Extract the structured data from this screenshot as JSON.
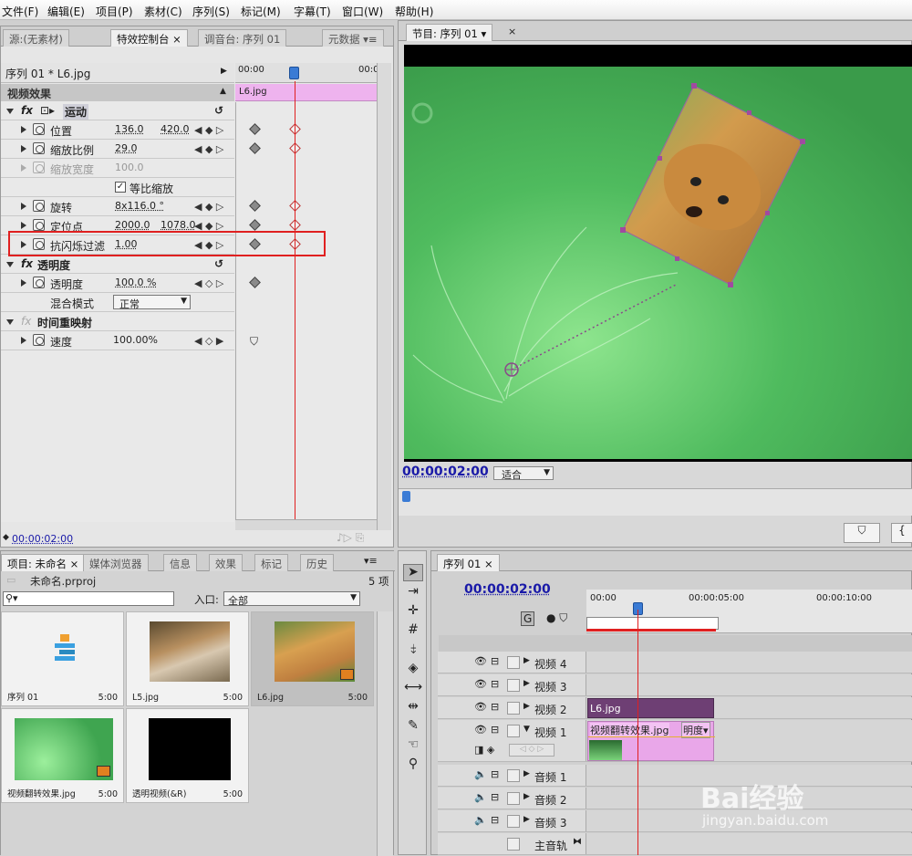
{
  "menu": [
    "文件(F)",
    "编辑(E)",
    "项目(P)",
    "素材(C)",
    "序列(S)",
    "标记(M)",
    "字幕(T)",
    "窗口(W)",
    "帮助(H)"
  ],
  "effects_panel": {
    "tabs": [
      "源:(无素材)",
      "特效控制台",
      "调音台: 序列 01",
      "元数据"
    ],
    "clip": "序列 01 * L6.jpg",
    "section": "视频效果",
    "ruler_start": "00:00",
    "ruler_end": "00:0",
    "clip_label": "L6.jpg",
    "motion": "运动",
    "props": [
      {
        "name": "位置",
        "v1": "136.0",
        "v2": "420.0"
      },
      {
        "name": "缩放比例",
        "v1": "29.0"
      },
      {
        "name": "缩放宽度",
        "v1": "100.0"
      },
      {
        "name": "等比缩放"
      },
      {
        "name": "旋转",
        "v1": "8x116.0 °"
      },
      {
        "name": "定位点",
        "v1": "2000.0",
        "v2": "1078.0"
      },
      {
        "name": "抗闪烁过滤",
        "v1": "1.00"
      }
    ],
    "opacity": "透明度",
    "opacity_prop": {
      "name": "透明度",
      "v1": "100.0 %"
    },
    "blend_label": "混合模式",
    "blend_value": "正常",
    "time_remap": "时间重映射",
    "speed": {
      "name": "速度",
      "v1": "100.00%"
    },
    "timecode": "00:00:02:00"
  },
  "program": {
    "tab": "节目: 序列 01",
    "timecode": "00:00:02:00",
    "fit": "适合"
  },
  "project": {
    "tabs": [
      "项目: 未命名",
      "媒体浏览器",
      "信息",
      "效果",
      "标记",
      "历史"
    ],
    "file": "未命名.prproj",
    "count": "5 项",
    "in_label": "入口:",
    "in_value": "全部",
    "items": [
      {
        "name": "序列 01",
        "dur": "5:00"
      },
      {
        "name": "L5.jpg",
        "dur": "5:00"
      },
      {
        "name": "L6.jpg",
        "dur": "5:00"
      },
      {
        "name": "视频翻转效果.jpg",
        "dur": "5:00"
      },
      {
        "name": "透明视频(&R)",
        "dur": "5:00"
      }
    ]
  },
  "timeline": {
    "tab": "序列 01",
    "timecode": "00:00:02:00",
    "ruler": [
      "00:00",
      "00:00:05:00",
      "00:00:10:00"
    ],
    "tracks": [
      "视频 4",
      "视频 3",
      "视频 2",
      "视频 1",
      "音频 1",
      "音频 2",
      "音频 3",
      "主音轨"
    ],
    "clip_v2": "L6.jpg",
    "clip_v1": "视频翻转效果.jpg",
    "clip_v1_opacity": "明度"
  },
  "watermark": {
    "brand": "Bai经验",
    "url": "jingyan.baidu.com"
  },
  "colors": {
    "highlight": "#e02020",
    "clip_pink": "#e9a7e9",
    "clip_purple": "#6e3f74",
    "timecode_blue": "#1a1aa8"
  }
}
